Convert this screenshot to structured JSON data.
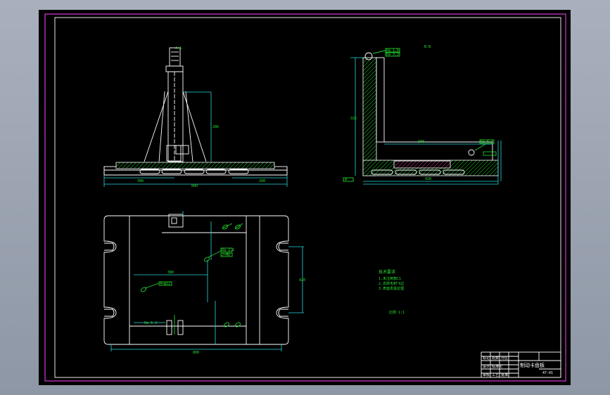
{
  "drawing": {
    "frame_colors": {
      "background": "#000000",
      "outer_border": "#d438d8",
      "inner_border": "#ffffff",
      "outline": "#22d22a",
      "dimension": "#27d8e2"
    },
    "notes": {
      "heading": "技术要求",
      "lines": [
        "1.未注倒角C1",
        "2.去除毛刺飞边",
        "3.表面发黑处理"
      ],
      "scale_label": "比例 1:1"
    },
    "title_block": {
      "part_name": "制动卡盘板",
      "drawing_no": "47-01",
      "rows": [
        "标记 处数 分区",
        "设计 标准化",
        "审核 工艺 批准"
      ]
    },
    "views": {
      "front": {
        "label": "A-A",
        "dim_total": "800",
        "dim_left": "300",
        "dim_right": "200",
        "dim_height": "280"
      },
      "side": {
        "label": "B-B",
        "dim_vertical": "335",
        "dim_horizontal": "380",
        "dim_bottom": "420",
        "callouts": [
          "Ra 1.6",
          "Ra 3.2",
          "Ra 6.3",
          "A"
        ]
      },
      "top": {
        "dim_total": "800",
        "dim_height": "420",
        "dim_inner": "380",
        "callouts": [
          "Ra 3.2",
          "2×M8",
          "4×φ12",
          "Ra 6.3"
        ]
      }
    }
  }
}
